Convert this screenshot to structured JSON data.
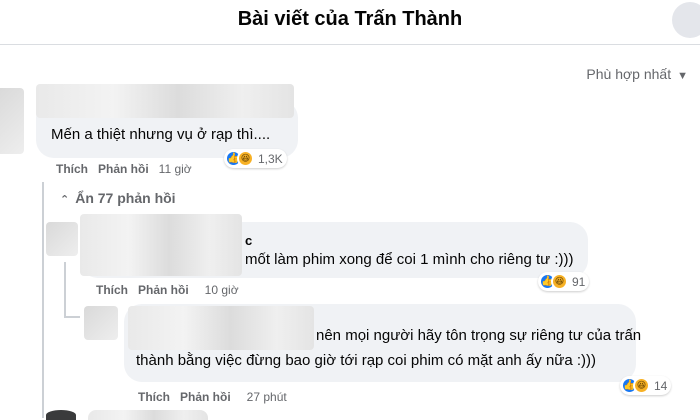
{
  "header": {
    "title": "Bài viết của Trấn Thành"
  },
  "sort": {
    "label": "Phù hợp nhất",
    "icon": "chevron-down-icon"
  },
  "comments": [
    {
      "text": "Mến a thiệt nhưng vụ ở rạp thì....",
      "like": "Thích",
      "reply": "Phản hồi",
      "time": "11 giờ",
      "reactions": [
        "like",
        "haha"
      ],
      "count": "1,3K"
    }
  ],
  "replies_toggle": {
    "label": "Ẩn 77 phản hồi",
    "icon": "chevron-up-icon"
  },
  "replies": [
    {
      "name_fragment": "c",
      "text": "mốt làm phim xong để coi 1 mình cho riêng tư :)))",
      "like": "Thích",
      "reply": "Phản hồi",
      "time": "10 giờ",
      "reactions": [
        "like",
        "haha"
      ],
      "count": "91"
    },
    {
      "text_line1": "nên mọi người hãy tôn trọng sự riêng tư của trấn",
      "text_line2": "thành bằng việc đừng bao giờ tới rạp coi phim có mặt anh ấy nữa :)))",
      "like": "Thích",
      "reply": "Phản hồi",
      "time": "27 phút",
      "reactions": [
        "like",
        "haha"
      ],
      "count": "14"
    }
  ],
  "colors": {
    "like": "#1877f2",
    "haha": "#f7b125",
    "bubble": "#f0f2f5",
    "meta": "#65676b"
  }
}
